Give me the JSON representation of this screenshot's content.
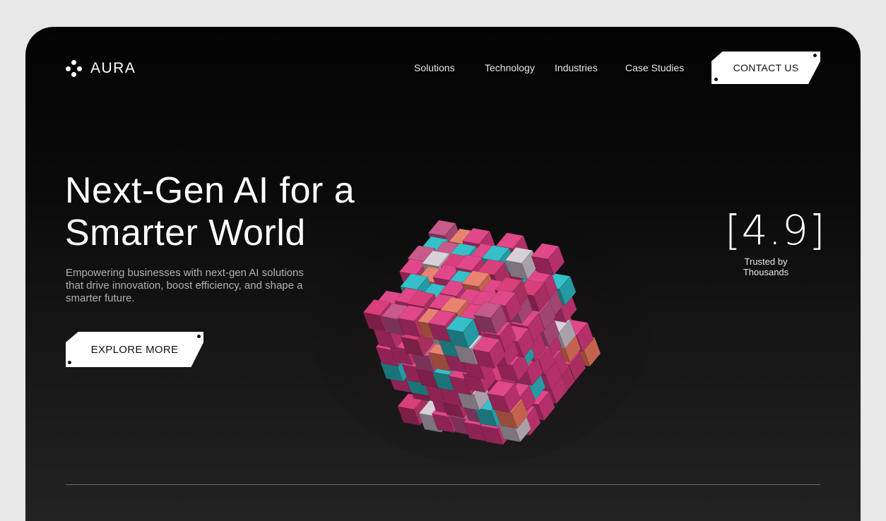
{
  "brand": {
    "name": "AURA",
    "logo_icon": "aura-logo-icon"
  },
  "nav": {
    "items": [
      {
        "label": "Solutions"
      },
      {
        "label": "Technology"
      },
      {
        "label": "Industries"
      },
      {
        "label": "Case Studies"
      }
    ],
    "cta_label": "CONTACT US"
  },
  "hero": {
    "title_line1": "Next-Gen AI for a",
    "title_line2": "Smarter World",
    "subtitle": "Empowering businesses with next-gen AI solutions that drive innovation, boost efficiency, and shape a smarter future.",
    "cta_label": "EXPLORE MORE",
    "image_icon": "voxel-cube-illustration"
  },
  "rating": {
    "value": "[4.9]",
    "caption_line1": "Trusted by",
    "caption_line2": "Thousands"
  },
  "colors": {
    "background": "#0b0b0b",
    "text": "#ffffff",
    "muted": "#b0b0b0",
    "cube_pink": "#d2407a",
    "cube_teal": "#2fb6c0",
    "cube_salmon": "#e07d6e"
  }
}
